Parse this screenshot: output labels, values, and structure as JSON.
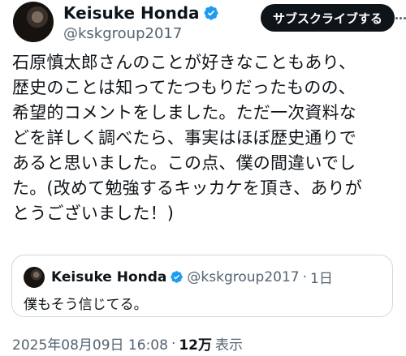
{
  "author": {
    "name": "Keisuke Honda",
    "handle": "@kskgroup2017"
  },
  "subscribe_label": "サブスクライブする",
  "tweet": {
    "text": "石原慎太郎さんのことが好きなこともあり、\n歴史のことは知ってたつもりだったものの、\n希望的コメントをしました。ただ一次資料な\nどを詳しく調べたら、事実はほぼ歴史通りで\nあると思いました。この点、僕の間違いでし\nた。(改めて勉強するキッカケを頂き、ありが\nとうございました！)"
  },
  "quote": {
    "name": "Keisuke Honda",
    "handle": "@kskgroup2017",
    "separator": "·",
    "time": "1日",
    "text": "僕もそう信じてる。"
  },
  "meta": {
    "timestamp": "2025年08月09日 16:08",
    "separator": "·",
    "views_count": "12万",
    "views_label": "表示"
  },
  "colors": {
    "verified": "#1d9bf0",
    "secondary_text": "#536471",
    "border": "#cfd9de"
  }
}
